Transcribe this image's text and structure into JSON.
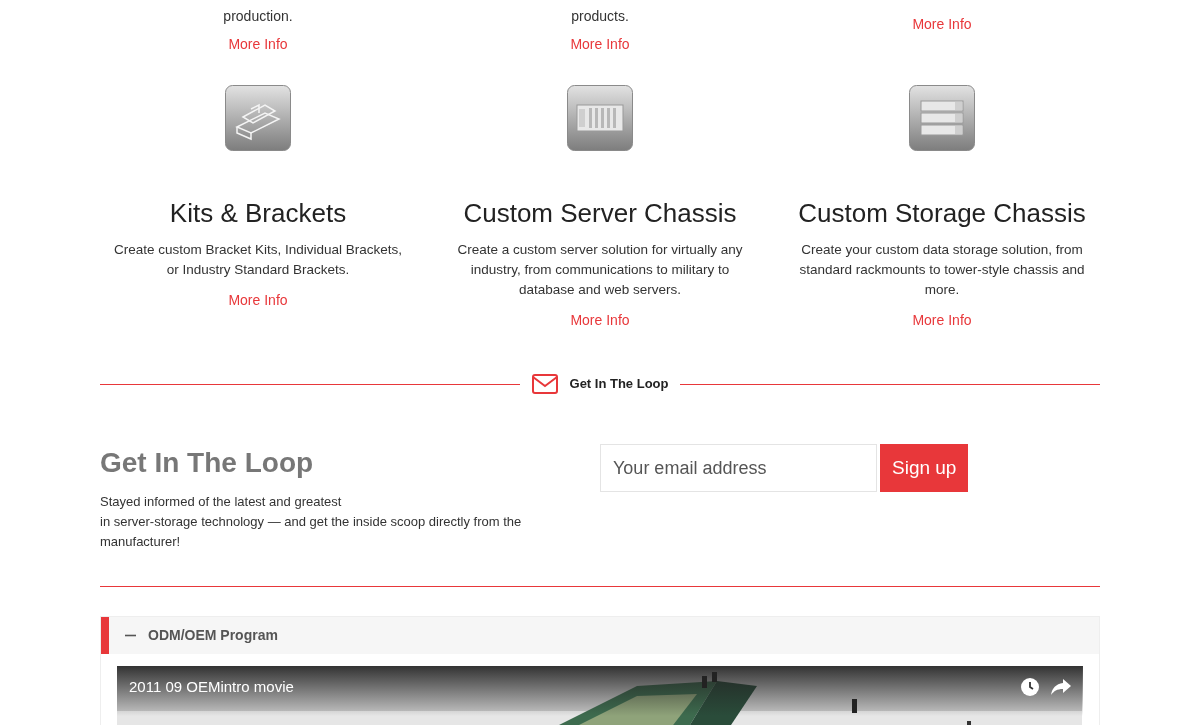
{
  "top_items": [
    {
      "lines": [
        "production."
      ],
      "link": "More Info"
    },
    {
      "lines": [
        "products."
      ],
      "link": "More Info"
    },
    {
      "link": "More Info"
    }
  ],
  "features": [
    {
      "kind": "brackets",
      "title": "Kits & Brackets",
      "description": "Create custom Bracket Kits, Individual Brackets, or Industry Standard Brackets.",
      "link": "More Info"
    },
    {
      "kind": "server",
      "title": "Custom Server Chassis",
      "description": "Create a custom server solution for virtually any industry, from communications to military to database and web servers.",
      "link": "More Info"
    },
    {
      "kind": "storage",
      "title": "Custom Storage Chassis",
      "description": "Create your custom data storage solution, from standard rackmounts to tower-style chassis and more.",
      "link": "More Info"
    }
  ],
  "divider": {
    "label": "Get In The Loop"
  },
  "newsletter": {
    "heading": "Get In The Loop",
    "text": "Stayed informed of the latest and greatest\nin server-storage technology — and get the inside scoop directly from the manufacturer!",
    "email": {
      "placeholder": "Your email address"
    },
    "button": "Sign up"
  },
  "accordion": {
    "title": "ODM/OEM Program",
    "expanded": true,
    "video": {
      "title": "2011 09 OEMintro movie"
    }
  }
}
